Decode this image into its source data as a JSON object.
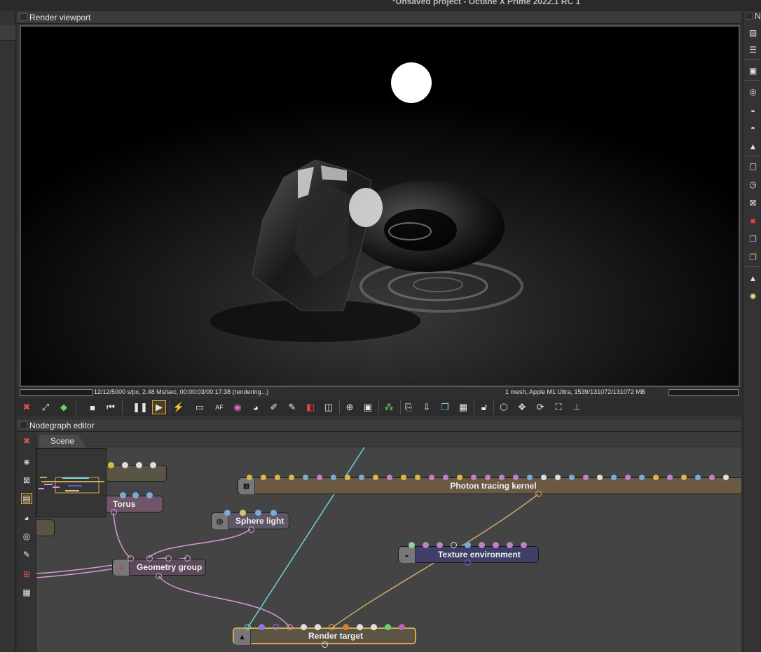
{
  "window": {
    "title": "*Unsaved project - Octane X Prime 2022.1 RC 1"
  },
  "render_viewport": {
    "header": "Render viewport",
    "status_left": "12/12/5000 s/px, 2.48 Ms/sec, 00:00:03/00:17:38 (rendering...)",
    "status_right": "1 mesh, Apple M1 Ultra, 1539/131072/131072 MB"
  },
  "render_toolbar": {
    "icons": [
      "stop-render-icon",
      "region-render-icon",
      "color-cube-icon",
      "stop-icon",
      "rewind-icon",
      "pause-icon",
      "play-icon",
      "lightning-icon",
      "monitor-icon",
      "af-icon",
      "color-wheel-icon",
      "material-picker-icon",
      "focus-picker-icon",
      "white-balance-icon",
      "clay-icon",
      "subsample-icon",
      "zoom-icon",
      "region-icon",
      "film-region-icon",
      "denoise-icon",
      "export-icon",
      "import-icon",
      "copy-icon",
      "checker-icon",
      "lock-icon",
      "cube-icon",
      "move-icon",
      "rotate-icon",
      "fullscreen-icon",
      "gizmo-icon"
    ],
    "af_label": "AF"
  },
  "nodegraph": {
    "header": "Nodegraph editor",
    "tab": "Scene",
    "nodes": {
      "photon": "Photon tracing kernel",
      "torus": "Torus",
      "sphere_light": "Sphere light",
      "geometry_group": "Geometry group",
      "texture_env": "Texture environment",
      "render_target": "Render target"
    }
  },
  "colors": {
    "accent_orange": "#d7a84a",
    "link_cyan": "#6cd3d8",
    "link_pink": "#d89ad4",
    "link_tan": "#cfa86a"
  }
}
